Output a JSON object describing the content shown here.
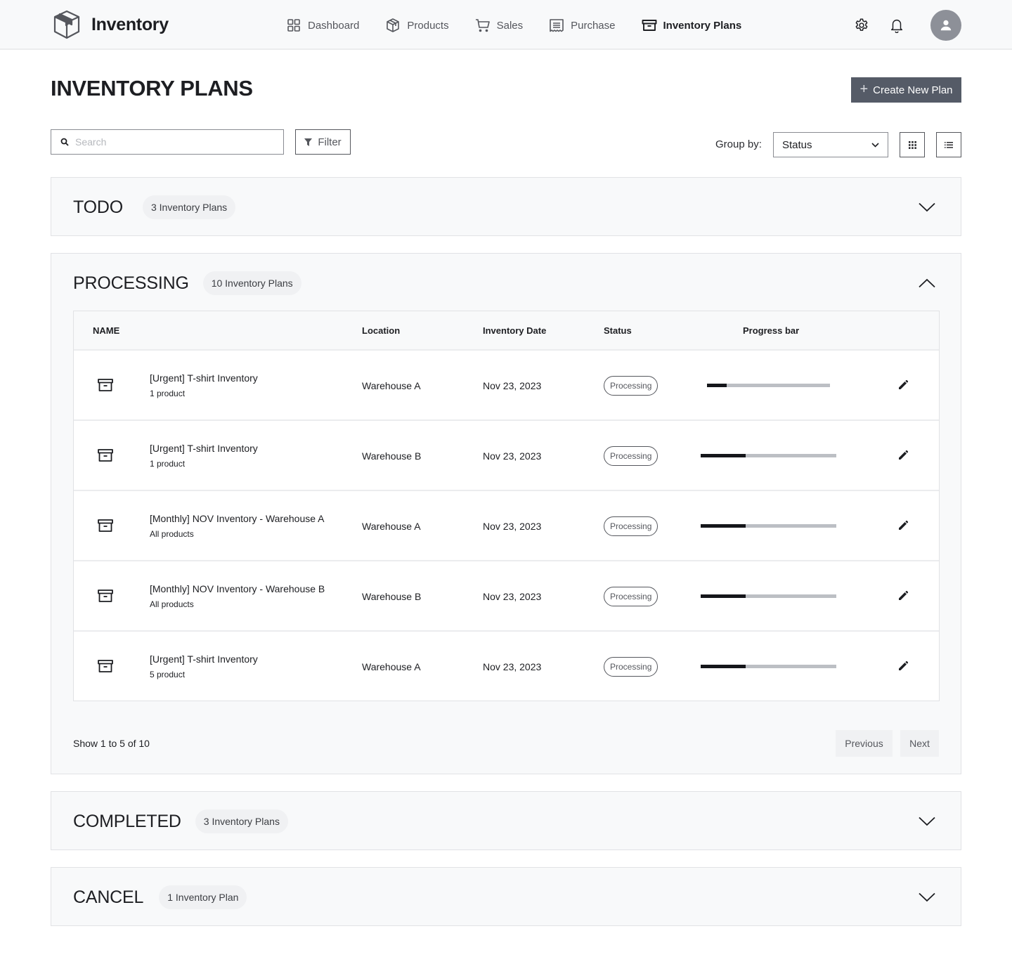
{
  "app": {
    "name": "Inventory",
    "logo_icon": "package-box-icon"
  },
  "nav": {
    "items": [
      {
        "label": "Dashboard",
        "icon": "grid-icon",
        "active": false
      },
      {
        "label": "Products",
        "icon": "cube-icon",
        "active": false
      },
      {
        "label": "Sales",
        "icon": "cart-icon",
        "active": false
      },
      {
        "label": "Purchase",
        "icon": "receipt-icon",
        "active": false
      },
      {
        "label": "Inventory Plans",
        "icon": "archive-icon",
        "active": true
      }
    ],
    "actions": [
      "gear-icon",
      "bell-icon",
      "user-avatar"
    ]
  },
  "page": {
    "title": "INVENTORY PLANS",
    "create_button": "Create New Plan"
  },
  "toolbar": {
    "search_placeholder": "Search",
    "search_value": "",
    "filter_label": "Filter",
    "group_by_label": "Group by:",
    "group_by_value": "Status",
    "view_modes": [
      "grid-view",
      "list-view"
    ]
  },
  "groups": [
    {
      "title": "TODO",
      "count": "3 Inventory Plans",
      "expanded": false
    },
    {
      "title": "PROCESSING",
      "count": "10 Inventory Plans",
      "expanded": true
    },
    {
      "title": "COMPLETED",
      "count": "3 Inventory Plans",
      "expanded": false
    },
    {
      "title": "CANCEL",
      "count": "1 Inventory Plan",
      "expanded": false
    }
  ],
  "table": {
    "columns": [
      "NAME",
      "Location",
      "Inventory Date",
      "Status",
      "Progress bar"
    ],
    "rows": [
      {
        "name": "[Urgent] T-shirt Inventory",
        "sub": "1 product",
        "location": "Warehouse A",
        "date": "Nov 23, 2023",
        "status": "Processing",
        "progress": 0.16
      },
      {
        "name": "[Urgent] T-shirt Inventory",
        "sub": "1 product",
        "location": "Warehouse B",
        "date": "Nov 23, 2023",
        "status": "Processing",
        "progress": 0.33
      },
      {
        "name": "[Monthly] NOV Inventory - Warehouse A",
        "sub": "All products",
        "location": "Warehouse A",
        "date": "Nov 23, 2023",
        "status": "Processing",
        "progress": 0.33
      },
      {
        "name": "[Monthly] NOV Inventory - Warehouse B",
        "sub": "All products",
        "location": "Warehouse B",
        "date": "Nov 23, 2023",
        "status": "Processing",
        "progress": 0.33
      },
      {
        "name": "[Urgent] T-shirt Inventory",
        "sub": "5 product",
        "location": "Warehouse A",
        "date": "Nov 23, 2023",
        "status": "Processing",
        "progress": 0.33
      }
    ]
  },
  "pagination": {
    "summary": "Show 1 to 5 of 10",
    "previous": "Previous",
    "next": "Next"
  }
}
